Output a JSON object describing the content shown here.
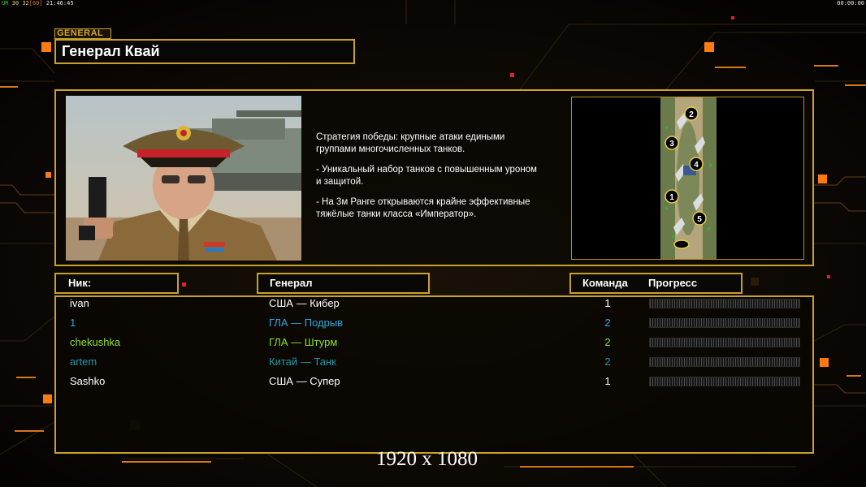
{
  "hud": {
    "top_left": {
      "fps_label": "ÜR",
      "a": "30",
      "b": "32",
      "c": "[60]",
      "clock": "21:46:45"
    },
    "top_right": "00:00:00"
  },
  "header": {
    "tag": "GENERAL",
    "title": "Генерал Квай"
  },
  "general_info": {
    "paragraphs": [
      "Стратегия победы: крупные атаки едиными\n группами многочисленных танков.",
      "- Уникальный набор танков с повышенным уроном\n и защитой.",
      "- На 3м Ранге открываются крайне эффективные\n тяжёлые танки класса «Император»."
    ],
    "map_slots": [
      "1",
      "2",
      "3",
      "4",
      "5"
    ]
  },
  "columns": {
    "nick": "Ник:",
    "general": "Генерал",
    "team": "Команда",
    "progress": "Прогресс"
  },
  "players": [
    {
      "nick": "ivan",
      "general": "США — Кибер",
      "team": "1",
      "color": "#ffffff",
      "progress": 0
    },
    {
      "nick": "1",
      "general": "ГЛА — Подрыв",
      "team": "2",
      "color": "#2ea8e0",
      "progress": 0
    },
    {
      "nick": "chekushka",
      "general": "ГЛА — Штурм",
      "team": "2",
      "color": "#8ee02a",
      "progress": 0
    },
    {
      "nick": "artem",
      "general": "Китай — Танк",
      "team": "2",
      "color": "#1e9aa8",
      "progress": 0
    },
    {
      "nick": "Sashko",
      "general": "США — Супер",
      "team": "1",
      "color": "#ffffff",
      "progress": 0
    }
  ],
  "resolution": "1920 x 1080",
  "colors": {
    "frame": "#c9a128",
    "accent_orange": "#ff7a10",
    "background": "#060402"
  }
}
